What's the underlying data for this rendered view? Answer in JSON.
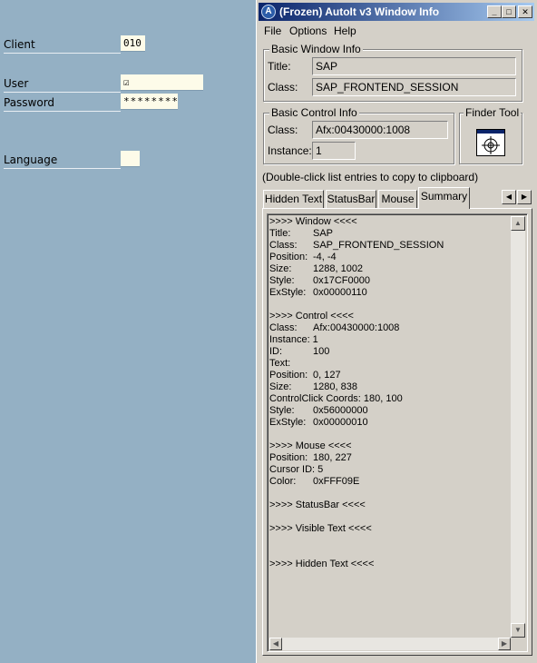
{
  "sap": {
    "client_label": "Client",
    "client_value": "010",
    "user_label": "User",
    "user_value": "☑",
    "password_label": "Password",
    "password_value": "********",
    "language_label": "Language",
    "language_value": ""
  },
  "autoit": {
    "title": "(Frozen) AutoIt v3 Window Info",
    "menu": [
      "File",
      "Options",
      "Help"
    ],
    "basic_window": {
      "heading": "Basic Window Info",
      "title_label": "Title:",
      "title_value": "SAP",
      "class_label": "Class:",
      "class_value": "SAP_FRONTEND_SESSION"
    },
    "basic_control": {
      "heading": "Basic Control Info",
      "class_label": "Class:",
      "class_value": "Afx:00430000:1008",
      "instance_label": "Instance:",
      "instance_value": "1"
    },
    "finder_tool": {
      "heading": "Finder Tool",
      "icon": "crosshair-icon"
    },
    "hint": "(Double-click list entries to copy to clipboard)",
    "tabs": [
      "Hidden Text",
      "StatusBar",
      "Mouse",
      "Summary"
    ],
    "active_tab": "Summary",
    "summary": {
      "window_header": ">>>> Window <<<<",
      "window": [
        {
          "k": "Title:",
          "v": "SAP"
        },
        {
          "k": "Class:",
          "v": "SAP_FRONTEND_SESSION"
        },
        {
          "k": "Position:",
          "v": "-4, -4"
        },
        {
          "k": "Size:",
          "v": "1288, 1002"
        },
        {
          "k": "Style:",
          "v": "0x17CF0000"
        },
        {
          "k": "ExStyle:",
          "v": "0x00000110"
        }
      ],
      "control_header": ">>>> Control <<<<",
      "control": [
        {
          "k": "Class:",
          "v": "Afx:00430000:1008"
        },
        {
          "k": "Instance:",
          "v": "1"
        },
        {
          "k": "ID:",
          "v": "100"
        },
        {
          "k": "Text:",
          "v": ""
        },
        {
          "k": "Position:",
          "v": "0, 127"
        },
        {
          "k": "Size:",
          "v": "1280, 838"
        },
        {
          "k": "ControlClick Coords:",
          "v": "180, 100"
        },
        {
          "k": "Style:",
          "v": "0x56000000"
        },
        {
          "k": "ExStyle:",
          "v": "0x00000010"
        }
      ],
      "mouse_header": ">>>> Mouse <<<<",
      "mouse": [
        {
          "k": "Position:",
          "v": "180, 227"
        },
        {
          "k": "Cursor ID:",
          "v": "5"
        },
        {
          "k": "Color:",
          "v": "0xFFF09E"
        }
      ],
      "statusbar_header": ">>>> StatusBar <<<<",
      "visible_text_header": ">>>> Visible Text <<<<",
      "hidden_text_header": ">>>> Hidden Text <<<<"
    }
  }
}
